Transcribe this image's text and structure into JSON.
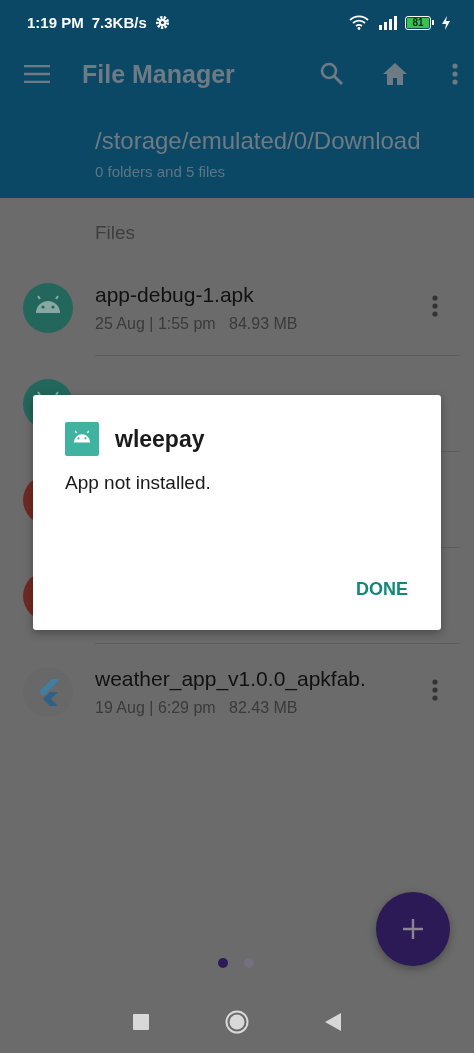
{
  "status_bar": {
    "time": "1:19 PM",
    "speed": "7.3KB/s",
    "battery": "81"
  },
  "app_bar": {
    "title": "File Manager",
    "path": "/storage/emulated/0/Download",
    "summary": "0 folders and 5 files"
  },
  "section": "Files",
  "files": [
    {
      "kind": "android",
      "title": "app-debug-1.apk",
      "meta": "25 Aug | 1:55 pm   84.93 MB"
    },
    {
      "kind": "android"
    },
    {
      "kind": "red"
    },
    {
      "kind": "red"
    },
    {
      "kind": "flutter",
      "title": "weather_app_v1.0.0_apkfab.",
      "meta": "19 Aug | 6:29 pm   82.43 MB"
    }
  ],
  "dialog": {
    "title": "wleepay",
    "message": "App not installed.",
    "button": "DONE"
  },
  "pager": [
    {
      "selected": true
    },
    {
      "selected": false
    }
  ]
}
